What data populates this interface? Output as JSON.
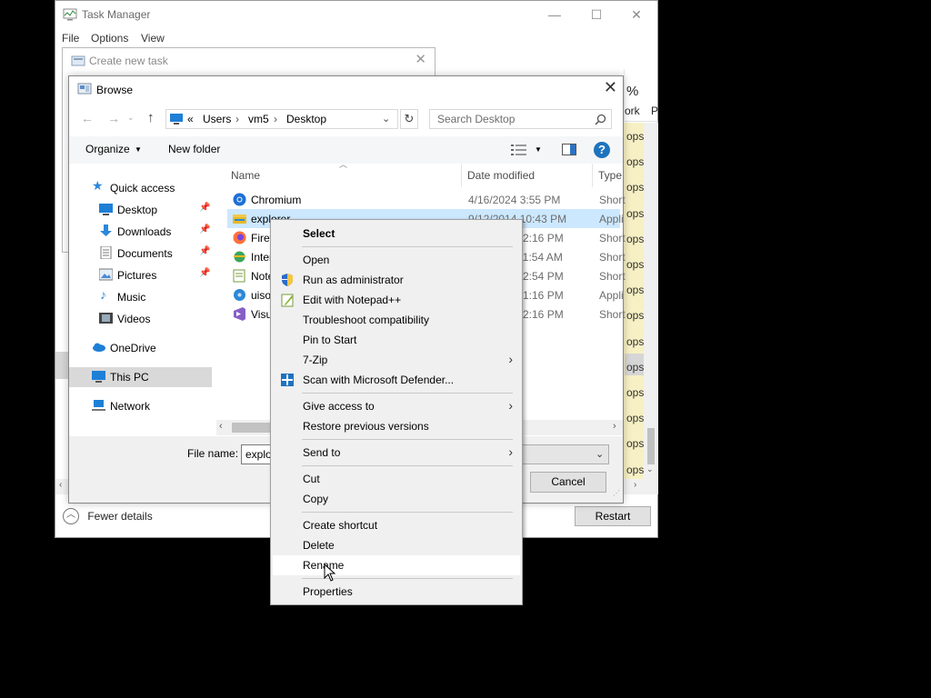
{
  "task_manager": {
    "title": "Task Manager",
    "menus": [
      "File",
      "Options",
      "View"
    ],
    "header_fragments": {
      "percent": "%",
      "network": "ork",
      "p": "P"
    },
    "ops_rows": [
      "ops",
      "ops",
      "ops",
      "ops",
      "ops",
      "ops",
      "ops",
      "ops",
      "ops",
      "ops",
      "ops",
      "ops",
      "ops",
      "ops"
    ],
    "fewer_details": "Fewer details",
    "restart_button": "Restart"
  },
  "create_new_task": {
    "title": "Create new task"
  },
  "browse": {
    "title": "Browse",
    "address": {
      "chevrons": "«",
      "parts": [
        "Users",
        "vm5",
        "Desktop"
      ]
    },
    "search_placeholder": "Search Desktop",
    "toolbar": {
      "organize": "Organize",
      "new_folder": "New folder"
    },
    "nav": {
      "quick_access": "Quick access",
      "desktop": "Desktop",
      "downloads": "Downloads",
      "documents": "Documents",
      "pictures": "Pictures",
      "music": "Music",
      "videos": "Videos",
      "onedrive": "OneDrive",
      "this_pc": "This PC",
      "network": "Network"
    },
    "columns": {
      "name": "Name",
      "date_modified": "Date modified",
      "type": "Type"
    },
    "files": [
      {
        "name": "Chromium",
        "date": "4/16/2024 3:55 PM",
        "type": "Short"
      },
      {
        "name": "explorer",
        "date": "9/12/2014 10:43 PM",
        "type": "Appli"
      },
      {
        "name": "Firef",
        "date": "2:16 PM",
        "type": "Short"
      },
      {
        "name": "Inter",
        "date": "11:54 AM",
        "type": "Short"
      },
      {
        "name": "Note",
        "date": "2:54 PM",
        "type": "Short"
      },
      {
        "name": "uiso",
        "date": "1:16 PM",
        "type": "Appli"
      },
      {
        "name": "Visu",
        "date": "2:16 PM",
        "type": "Short"
      }
    ],
    "file_name_label": "File name:",
    "file_name_value": "explo",
    "cancel_button": "Cancel"
  },
  "context_menu": {
    "items": {
      "select": "Select",
      "open": "Open",
      "run_admin": "Run as administrator",
      "edit_notepad": "Edit with Notepad++",
      "troubleshoot": "Troubleshoot compatibility",
      "pin_start": "Pin to Start",
      "seven_zip": "7-Zip",
      "defender": "Scan with Microsoft Defender...",
      "give_access": "Give access to",
      "restore_versions": "Restore previous versions",
      "send_to": "Send to",
      "cut": "Cut",
      "copy": "Copy",
      "create_shortcut": "Create shortcut",
      "delete": "Delete",
      "rename": "Rename",
      "properties": "Properties"
    },
    "hovered_item": "Rename"
  },
  "colors": {
    "selection": "#cce8ff",
    "highlight_yellow": "#f7f0c4",
    "menu_bg": "#f0f0f0",
    "help_blue": "#1e73be"
  }
}
